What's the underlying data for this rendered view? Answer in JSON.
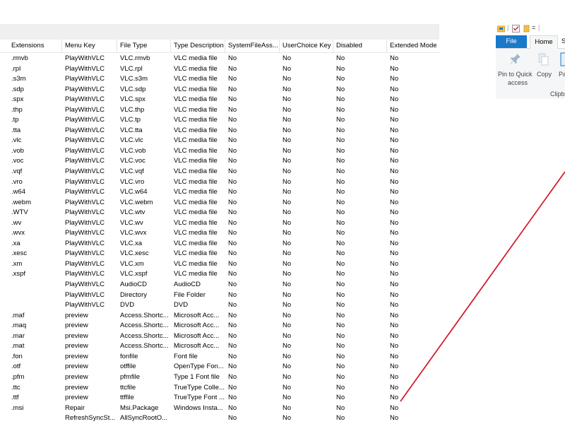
{
  "list": {
    "columns": [
      "Extensions",
      "Menu Key",
      "File Type",
      "Type Description",
      "SystemFileAss...",
      "UserChoice Key",
      "Disabled",
      "Extended Mode"
    ],
    "rows": [
      [
        ".rmvb",
        "PlayWithVLC",
        "VLC.rmvb",
        "VLC media file",
        "No",
        "No",
        "No",
        "No"
      ],
      [
        ".rpl",
        "PlayWithVLC",
        "VLC.rpl",
        "VLC media file",
        "No",
        "No",
        "No",
        "No"
      ],
      [
        ".s3m",
        "PlayWithVLC",
        "VLC.s3m",
        "VLC media file",
        "No",
        "No",
        "No",
        "No"
      ],
      [
        ".sdp",
        "PlayWithVLC",
        "VLC.sdp",
        "VLC media file",
        "No",
        "No",
        "No",
        "No"
      ],
      [
        ".spx",
        "PlayWithVLC",
        "VLC.spx",
        "VLC media file",
        "No",
        "No",
        "No",
        "No"
      ],
      [
        ".thp",
        "PlayWithVLC",
        "VLC.thp",
        "VLC media file",
        "No",
        "No",
        "No",
        "No"
      ],
      [
        ".tp",
        "PlayWithVLC",
        "VLC.tp",
        "VLC media file",
        "No",
        "No",
        "No",
        "No"
      ],
      [
        ".tta",
        "PlayWithVLC",
        "VLC.tta",
        "VLC media file",
        "No",
        "No",
        "No",
        "No"
      ],
      [
        ".vlc",
        "PlayWithVLC",
        "VLC.vlc",
        "VLC media file",
        "No",
        "No",
        "No",
        "No"
      ],
      [
        ".vob",
        "PlayWithVLC",
        "VLC.vob",
        "VLC media file",
        "No",
        "No",
        "No",
        "No"
      ],
      [
        ".voc",
        "PlayWithVLC",
        "VLC.voc",
        "VLC media file",
        "No",
        "No",
        "No",
        "No"
      ],
      [
        ".vqf",
        "PlayWithVLC",
        "VLC.vqf",
        "VLC media file",
        "No",
        "No",
        "No",
        "No"
      ],
      [
        ".vro",
        "PlayWithVLC",
        "VLC.vro",
        "VLC media file",
        "No",
        "No",
        "No",
        "No"
      ],
      [
        ".w64",
        "PlayWithVLC",
        "VLC.w64",
        "VLC media file",
        "No",
        "No",
        "No",
        "No"
      ],
      [
        ".webm",
        "PlayWithVLC",
        "VLC.webm",
        "VLC media file",
        "No",
        "No",
        "No",
        "No"
      ],
      [
        ".WTV",
        "PlayWithVLC",
        "VLC.wtv",
        "VLC media file",
        "No",
        "No",
        "No",
        "No"
      ],
      [
        ".wv",
        "PlayWithVLC",
        "VLC.wv",
        "VLC media file",
        "No",
        "No",
        "No",
        "No"
      ],
      [
        ".wvx",
        "PlayWithVLC",
        "VLC.wvx",
        "VLC media file",
        "No",
        "No",
        "No",
        "No"
      ],
      [
        ".xa",
        "PlayWithVLC",
        "VLC.xa",
        "VLC media file",
        "No",
        "No",
        "No",
        "No"
      ],
      [
        ".xesc",
        "PlayWithVLC",
        "VLC.xesc",
        "VLC media file",
        "No",
        "No",
        "No",
        "No"
      ],
      [
        ".xm",
        "PlayWithVLC",
        "VLC.xm",
        "VLC media file",
        "No",
        "No",
        "No",
        "No"
      ],
      [
        ".xspf",
        "PlayWithVLC",
        "VLC.xspf",
        "VLC media file",
        "No",
        "No",
        "No",
        "No"
      ],
      [
        "",
        "PlayWithVLC",
        "AudioCD",
        "AudioCD",
        "No",
        "No",
        "No",
        "No"
      ],
      [
        "",
        "PlayWithVLC",
        "Directory",
        "File Folder",
        "No",
        "No",
        "No",
        "No"
      ],
      [
        "",
        "PlayWithVLC",
        "DVD",
        "DVD",
        "No",
        "No",
        "No",
        "No"
      ],
      [
        ".maf",
        "preview",
        "Access.Shortc...",
        "Microsoft Acc...",
        "No",
        "No",
        "No",
        "No"
      ],
      [
        ".maq",
        "preview",
        "Access.Shortc...",
        "Microsoft Acc...",
        "No",
        "No",
        "No",
        "No"
      ],
      [
        ".mar",
        "preview",
        "Access.Shortc...",
        "Microsoft Acc...",
        "No",
        "No",
        "No",
        "No"
      ],
      [
        ".mat",
        "preview",
        "Access.Shortc...",
        "Microsoft Acc...",
        "No",
        "No",
        "No",
        "No"
      ],
      [
        ".fon",
        "preview",
        "fonfile",
        "Font file",
        "No",
        "No",
        "No",
        "No"
      ],
      [
        ".otf",
        "preview",
        "otffile",
        "OpenType Fon...",
        "No",
        "No",
        "No",
        "No"
      ],
      [
        ".pfm",
        "preview",
        "pfmfile",
        "Type 1 Font file",
        "No",
        "No",
        "No",
        "No"
      ],
      [
        ".ttc",
        "preview",
        "ttcfile",
        "TrueType Colle...",
        "No",
        "No",
        "No",
        "No"
      ],
      [
        ".ttf",
        "preview",
        "ttffile",
        "TrueType Font ...",
        "No",
        "No",
        "No",
        "No"
      ],
      [
        ".msi",
        "Repair",
        "Msi.Package",
        "Windows Insta...",
        "No",
        "No",
        "No",
        "No"
      ],
      [
        "",
        "RefreshSyncSt...",
        "AllSyncRootO...",
        "",
        "No",
        "No",
        "No",
        "No"
      ]
    ]
  },
  "explorer": {
    "qat_separator": "|",
    "qat_dropdown": "=",
    "tabs": {
      "file": "File",
      "home": "Home",
      "more": "S"
    },
    "ribbon": {
      "pin_label_1": "Pin to Quick",
      "pin_label_2": "access",
      "copy_label": "Copy",
      "paste_label": "Pa",
      "group_label": "Clipbo"
    }
  },
  "colors": {
    "accent": "#1979ca",
    "annotation": "#d41d2c",
    "topbar": "#efefef"
  }
}
